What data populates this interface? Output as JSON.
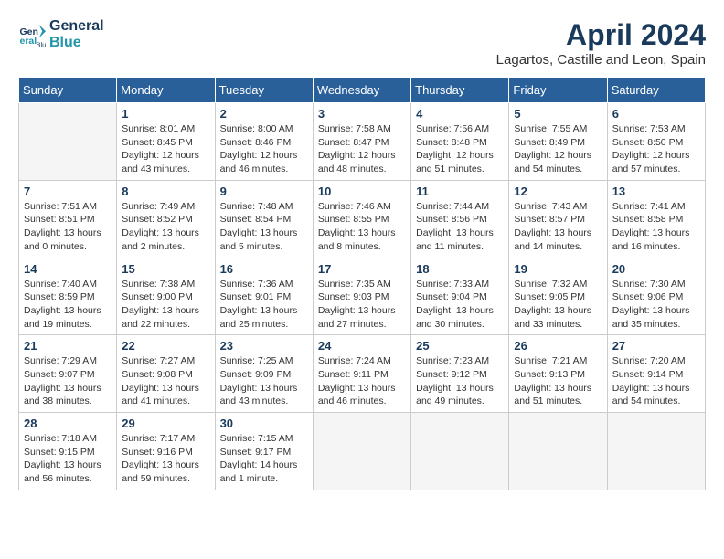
{
  "logo": {
    "line1": "General",
    "line2": "Blue"
  },
  "title": "April 2024",
  "subtitle": "Lagartos, Castille and Leon, Spain",
  "days_of_week": [
    "Sunday",
    "Monday",
    "Tuesday",
    "Wednesday",
    "Thursday",
    "Friday",
    "Saturday"
  ],
  "weeks": [
    [
      {
        "day": "",
        "info": ""
      },
      {
        "day": "1",
        "info": "Sunrise: 8:01 AM\nSunset: 8:45 PM\nDaylight: 12 hours\nand 43 minutes."
      },
      {
        "day": "2",
        "info": "Sunrise: 8:00 AM\nSunset: 8:46 PM\nDaylight: 12 hours\nand 46 minutes."
      },
      {
        "day": "3",
        "info": "Sunrise: 7:58 AM\nSunset: 8:47 PM\nDaylight: 12 hours\nand 48 minutes."
      },
      {
        "day": "4",
        "info": "Sunrise: 7:56 AM\nSunset: 8:48 PM\nDaylight: 12 hours\nand 51 minutes."
      },
      {
        "day": "5",
        "info": "Sunrise: 7:55 AM\nSunset: 8:49 PM\nDaylight: 12 hours\nand 54 minutes."
      },
      {
        "day": "6",
        "info": "Sunrise: 7:53 AM\nSunset: 8:50 PM\nDaylight: 12 hours\nand 57 minutes."
      }
    ],
    [
      {
        "day": "7",
        "info": "Sunrise: 7:51 AM\nSunset: 8:51 PM\nDaylight: 13 hours\nand 0 minutes."
      },
      {
        "day": "8",
        "info": "Sunrise: 7:49 AM\nSunset: 8:52 PM\nDaylight: 13 hours\nand 2 minutes."
      },
      {
        "day": "9",
        "info": "Sunrise: 7:48 AM\nSunset: 8:54 PM\nDaylight: 13 hours\nand 5 minutes."
      },
      {
        "day": "10",
        "info": "Sunrise: 7:46 AM\nSunset: 8:55 PM\nDaylight: 13 hours\nand 8 minutes."
      },
      {
        "day": "11",
        "info": "Sunrise: 7:44 AM\nSunset: 8:56 PM\nDaylight: 13 hours\nand 11 minutes."
      },
      {
        "day": "12",
        "info": "Sunrise: 7:43 AM\nSunset: 8:57 PM\nDaylight: 13 hours\nand 14 minutes."
      },
      {
        "day": "13",
        "info": "Sunrise: 7:41 AM\nSunset: 8:58 PM\nDaylight: 13 hours\nand 16 minutes."
      }
    ],
    [
      {
        "day": "14",
        "info": "Sunrise: 7:40 AM\nSunset: 8:59 PM\nDaylight: 13 hours\nand 19 minutes."
      },
      {
        "day": "15",
        "info": "Sunrise: 7:38 AM\nSunset: 9:00 PM\nDaylight: 13 hours\nand 22 minutes."
      },
      {
        "day": "16",
        "info": "Sunrise: 7:36 AM\nSunset: 9:01 PM\nDaylight: 13 hours\nand 25 minutes."
      },
      {
        "day": "17",
        "info": "Sunrise: 7:35 AM\nSunset: 9:03 PM\nDaylight: 13 hours\nand 27 minutes."
      },
      {
        "day": "18",
        "info": "Sunrise: 7:33 AM\nSunset: 9:04 PM\nDaylight: 13 hours\nand 30 minutes."
      },
      {
        "day": "19",
        "info": "Sunrise: 7:32 AM\nSunset: 9:05 PM\nDaylight: 13 hours\nand 33 minutes."
      },
      {
        "day": "20",
        "info": "Sunrise: 7:30 AM\nSunset: 9:06 PM\nDaylight: 13 hours\nand 35 minutes."
      }
    ],
    [
      {
        "day": "21",
        "info": "Sunrise: 7:29 AM\nSunset: 9:07 PM\nDaylight: 13 hours\nand 38 minutes."
      },
      {
        "day": "22",
        "info": "Sunrise: 7:27 AM\nSunset: 9:08 PM\nDaylight: 13 hours\nand 41 minutes."
      },
      {
        "day": "23",
        "info": "Sunrise: 7:25 AM\nSunset: 9:09 PM\nDaylight: 13 hours\nand 43 minutes."
      },
      {
        "day": "24",
        "info": "Sunrise: 7:24 AM\nSunset: 9:11 PM\nDaylight: 13 hours\nand 46 minutes."
      },
      {
        "day": "25",
        "info": "Sunrise: 7:23 AM\nSunset: 9:12 PM\nDaylight: 13 hours\nand 49 minutes."
      },
      {
        "day": "26",
        "info": "Sunrise: 7:21 AM\nSunset: 9:13 PM\nDaylight: 13 hours\nand 51 minutes."
      },
      {
        "day": "27",
        "info": "Sunrise: 7:20 AM\nSunset: 9:14 PM\nDaylight: 13 hours\nand 54 minutes."
      }
    ],
    [
      {
        "day": "28",
        "info": "Sunrise: 7:18 AM\nSunset: 9:15 PM\nDaylight: 13 hours\nand 56 minutes."
      },
      {
        "day": "29",
        "info": "Sunrise: 7:17 AM\nSunset: 9:16 PM\nDaylight: 13 hours\nand 59 minutes."
      },
      {
        "day": "30",
        "info": "Sunrise: 7:15 AM\nSunset: 9:17 PM\nDaylight: 14 hours\nand 1 minute."
      },
      {
        "day": "",
        "info": ""
      },
      {
        "day": "",
        "info": ""
      },
      {
        "day": "",
        "info": ""
      },
      {
        "day": "",
        "info": ""
      }
    ]
  ]
}
